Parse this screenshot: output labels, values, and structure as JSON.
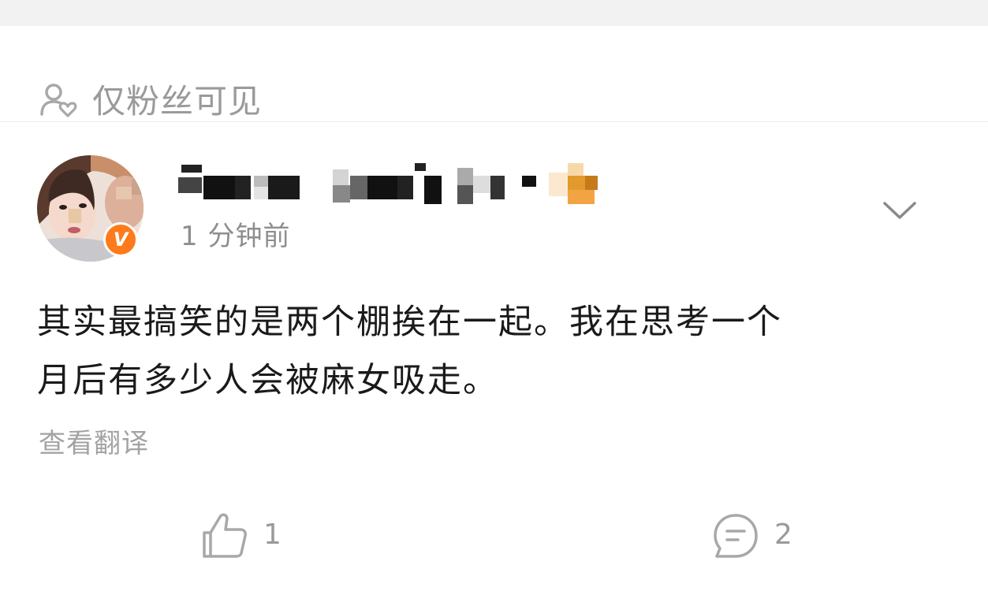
{
  "visibility": {
    "icon": "user-heart-icon",
    "label": "仅粉丝可见"
  },
  "post": {
    "author": {
      "avatar_icon": "avatar-photo",
      "verified_badge": "V",
      "name_pixelated": true
    },
    "time": "1 分钟前",
    "menu_icon": "chevron-down-icon",
    "content_line1": "其实最搞笑的是两个棚挨在一起。我在思考一个",
    "content_line2": "月后有多少人会被麻女吸走。",
    "translate_label": "查看翻译"
  },
  "actions": {
    "like": {
      "icon": "thumbs-up-icon",
      "count": "1"
    },
    "comment": {
      "icon": "comment-icon",
      "count": "2"
    }
  },
  "colors": {
    "badge": "#ff7a1a",
    "muted_text": "#9a9a9a",
    "body_text": "#1a1a1a"
  }
}
